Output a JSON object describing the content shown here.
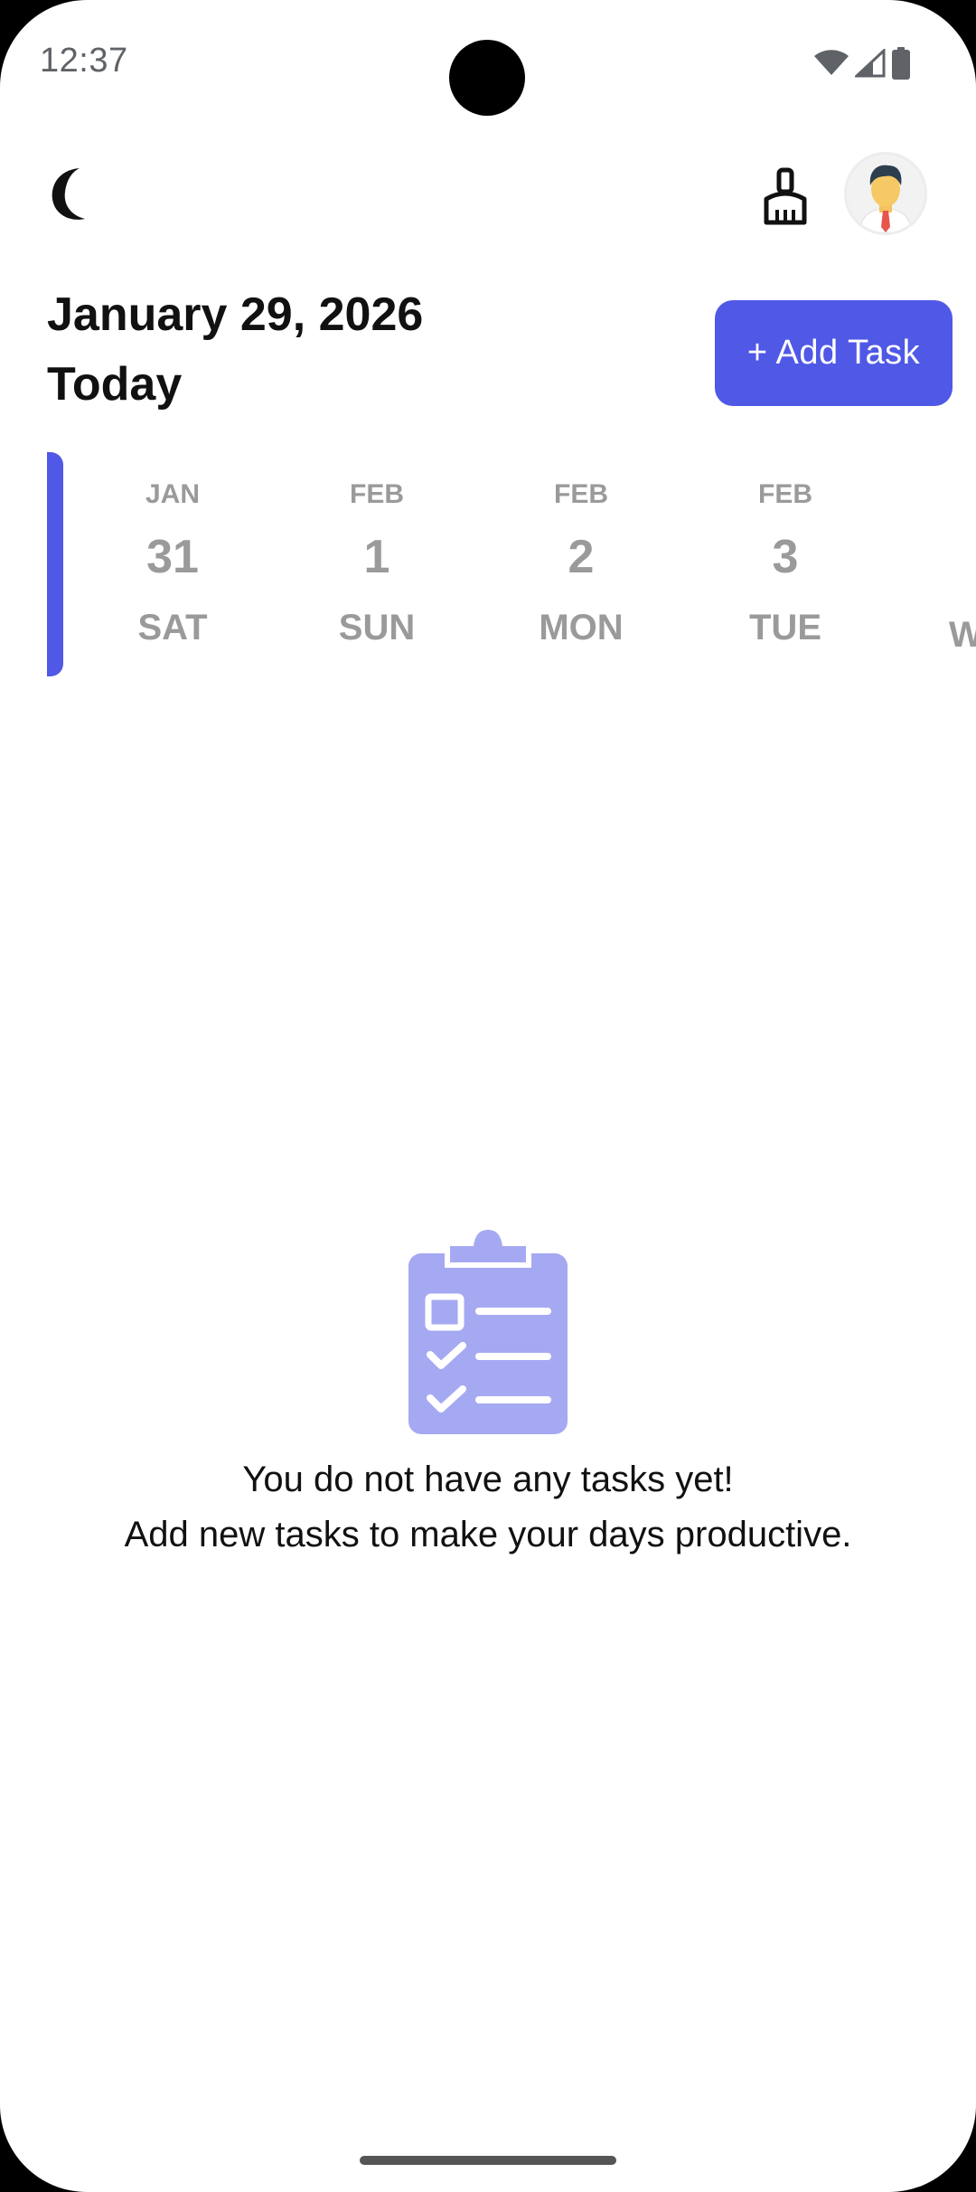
{
  "status_bar": {
    "time": "12:37",
    "icons": [
      "wifi-icon",
      "signal-icon",
      "battery-icon"
    ]
  },
  "app_bar": {
    "theme_toggle_icon": "moon-icon",
    "clear_icon": "broom-icon",
    "avatar_icon": "user-avatar"
  },
  "header": {
    "date": "January 29, 2026",
    "subtitle": "Today",
    "add_task_label": "+ Add Task"
  },
  "date_strip": {
    "days": [
      {
        "month": "JAN",
        "day": "31",
        "weekday": "SAT"
      },
      {
        "month": "FEB",
        "day": "1",
        "weekday": "SUN"
      },
      {
        "month": "FEB",
        "day": "2",
        "weekday": "MON"
      },
      {
        "month": "FEB",
        "day": "3",
        "weekday": "TUE"
      }
    ],
    "peek_weekday": "W"
  },
  "empty_state": {
    "icon": "clipboard-checklist-icon",
    "line1": "You do not have any tasks yet!",
    "line2": "Add new tasks to make your days productive."
  },
  "colors": {
    "accent": "#5058e6",
    "muted_text": "#9a9a9a",
    "illustration": "#a5a9f2"
  }
}
